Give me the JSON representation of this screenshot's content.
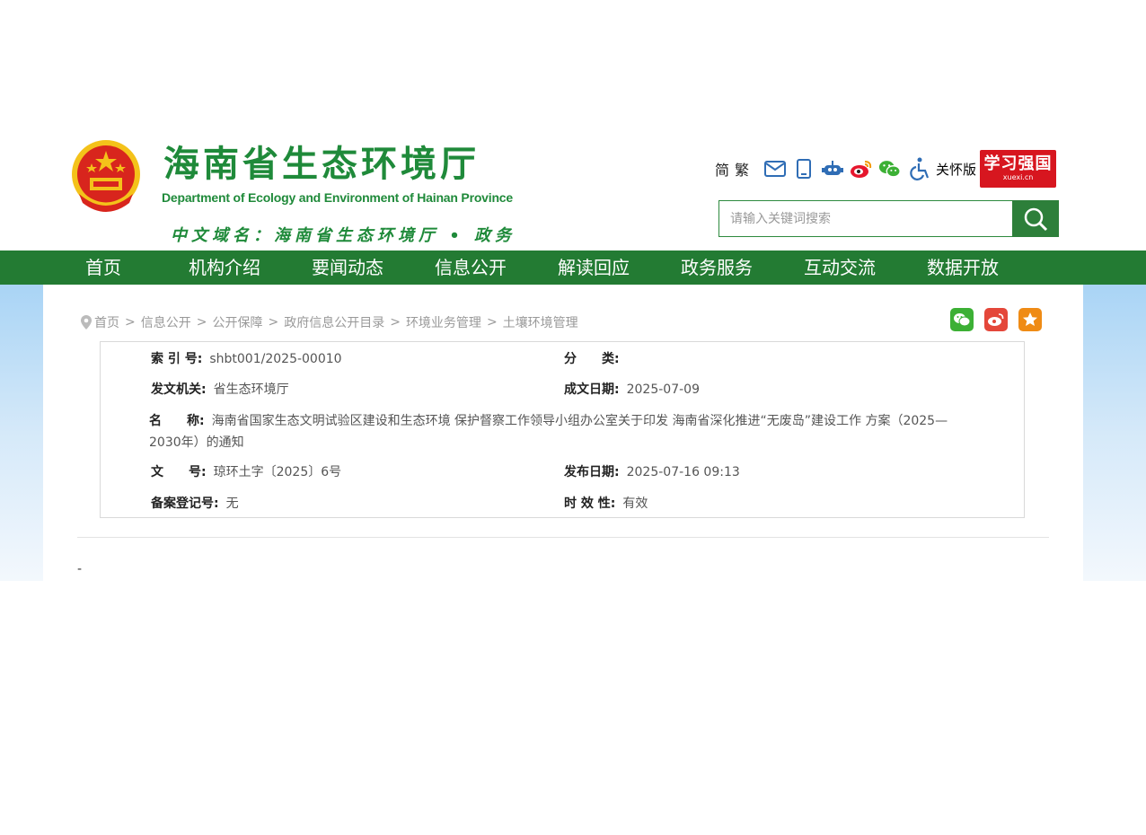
{
  "header": {
    "title": "海南省生态环境厅",
    "subtitle": "Department of Ecology and Environment of Hainan Province",
    "domain": "中文域名：海南省生态环境厅 • 政务"
  },
  "toolbar": {
    "simplified": "简",
    "traditional": "繁",
    "icons": [
      "mail-icon",
      "mobile-icon",
      "robot-icon",
      "weibo-icon",
      "wechat-icon",
      "accessibility-icon"
    ],
    "care_label": "关怀版",
    "xuexi_big": "学习强国",
    "xuexi_small": "xuexi.cn"
  },
  "search": {
    "placeholder": "请输入关键词搜索"
  },
  "nav": {
    "items": [
      "首页",
      "机构介绍",
      "要闻动态",
      "信息公开",
      "解读回应",
      "政务服务",
      "互动交流",
      "数据开放"
    ]
  },
  "breadcrumb": {
    "items": [
      "首页",
      "信息公开",
      "公开保障",
      "政府信息公开目录",
      "环境业务管理",
      "土壤环境管理"
    ],
    "separator": ">"
  },
  "share": {
    "icons": [
      "wechat-share-icon",
      "weibo-share-icon",
      "favorite-icon"
    ]
  },
  "meta": {
    "index_label": "索 引 号:",
    "index_value": "shbt001/2025-00010",
    "category_label": "分　　类:",
    "category_value": "",
    "issuer_label": "发文机关:",
    "issuer_value": "省生态环境厅",
    "written_label": "成文日期:",
    "written_value": "2025-07-09",
    "name_label": "名　　称:",
    "name_value": "海南省国家生态文明试验区建设和生态环境 保护督察工作领导小组办公室关于印发 海南省深化推进“无废岛”建设工作 方案（2025—2030年）的通知",
    "docno_label": "文　　号:",
    "docno_value": "琼环土字〔2025〕6号",
    "published_label": "发布日期:",
    "published_value": "2025-07-16 09:13",
    "record_label": "备案登记号:",
    "record_value": "无",
    "validity_label": "时 效 性:",
    "validity_value": "有效"
  },
  "body": {
    "text": "-"
  },
  "colors": {
    "brand_green": "#237b33",
    "title_green": "#1f8a3a",
    "xuexi_red": "#d7161f"
  }
}
